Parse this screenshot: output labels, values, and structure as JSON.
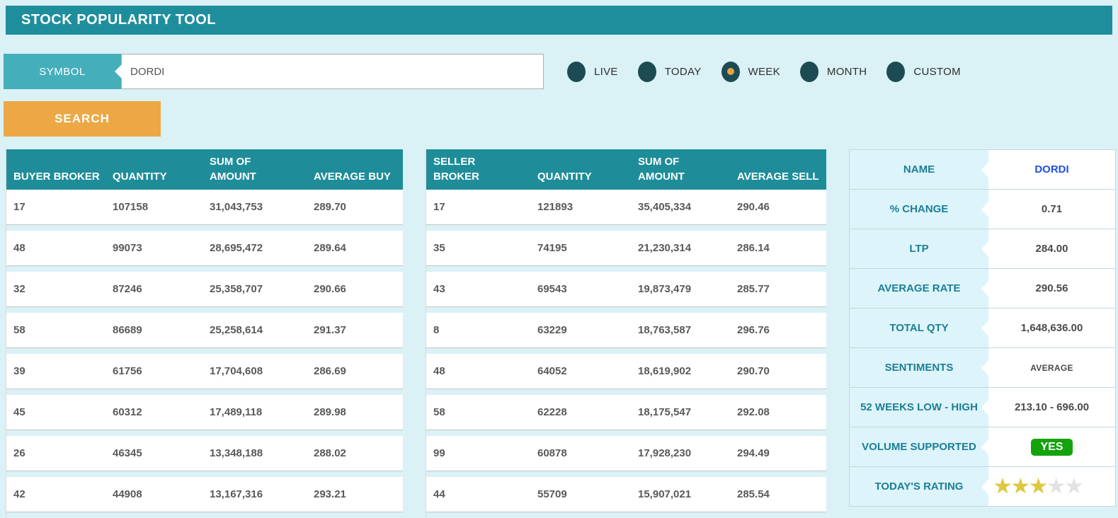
{
  "title": "STOCK POPULARITY TOOL",
  "search": {
    "symbol_label": "SYMBOL",
    "symbol_value": "DORDI",
    "button_label": "SEARCH"
  },
  "periods": [
    {
      "label": "LIVE",
      "selected": false
    },
    {
      "label": "TODAY",
      "selected": false
    },
    {
      "label": "WEEK",
      "selected": true
    },
    {
      "label": "MONTH",
      "selected": false
    },
    {
      "label": "CUSTOM",
      "selected": false
    }
  ],
  "buyer_table": {
    "headers": [
      "BUYER BROKER",
      "QUANTITY",
      "SUM OF AMOUNT",
      "AVERAGE BUY"
    ],
    "rows": [
      [
        "17",
        "107158",
        "31,043,753",
        "289.70"
      ],
      [
        "48",
        "99073",
        "28,695,472",
        "289.64"
      ],
      [
        "32",
        "87246",
        "25,358,707",
        "290.66"
      ],
      [
        "58",
        "86689",
        "25,258,614",
        "291.37"
      ],
      [
        "39",
        "61756",
        "17,704,608",
        "286.69"
      ],
      [
        "45",
        "60312",
        "17,489,118",
        "289.98"
      ],
      [
        "26",
        "46345",
        "13,348,188",
        "288.02"
      ],
      [
        "42",
        "44908",
        "13,167,316",
        "293.21"
      ]
    ]
  },
  "seller_table": {
    "headers": [
      "SELLER BROKER",
      "QUANTITY",
      "SUM OF AMOUNT",
      "AVERAGE SELL"
    ],
    "rows": [
      [
        "17",
        "121893",
        "35,405,334",
        "290.46"
      ],
      [
        "35",
        "74195",
        "21,230,314",
        "286.14"
      ],
      [
        "43",
        "69543",
        "19,873,479",
        "285.77"
      ],
      [
        "8",
        "63229",
        "18,763,587",
        "296.76"
      ],
      [
        "48",
        "64052",
        "18,619,902",
        "290.70"
      ],
      [
        "58",
        "62228",
        "18,175,547",
        "292.08"
      ],
      [
        "99",
        "60878",
        "17,928,230",
        "294.49"
      ],
      [
        "44",
        "55709",
        "15,907,021",
        "285.54"
      ]
    ]
  },
  "stats": {
    "rows": [
      {
        "label": "NAME",
        "value": "DORDI",
        "type": "name"
      },
      {
        "label": "% CHANGE",
        "value": "0.71",
        "type": "text"
      },
      {
        "label": "LTP",
        "value": "284.00",
        "type": "text"
      },
      {
        "label": "AVERAGE RATE",
        "value": "290.56",
        "type": "text"
      },
      {
        "label": "TOTAL QTY",
        "value": "1,648,636.00",
        "type": "text"
      },
      {
        "label": "SENTIMENTS",
        "value": "AVERAGE",
        "type": "small"
      },
      {
        "label": "52 WEEKS LOW - HIGH",
        "value": "213.10 - 696.00",
        "type": "text"
      },
      {
        "label": "VOLUME SUPPORTED",
        "value": "YES",
        "type": "badge"
      },
      {
        "label": "TODAY'S RATING",
        "rating": 3,
        "max": 5,
        "type": "stars"
      }
    ]
  },
  "colors": {
    "page_bg": "#daf1f6",
    "header_teal": "#1f8e9c",
    "table_header_teal": "#1e8d99",
    "symbol_teal": "#45aebb",
    "search_orange": "#eba844",
    "radio_dark": "#1c4b54",
    "radio_dot_orange": "#e8a33d",
    "name_blue": "#1d52e0",
    "badge_green": "#14a30d",
    "star_gold": "#ddc83e",
    "star_empty": "#e2e2e2"
  }
}
